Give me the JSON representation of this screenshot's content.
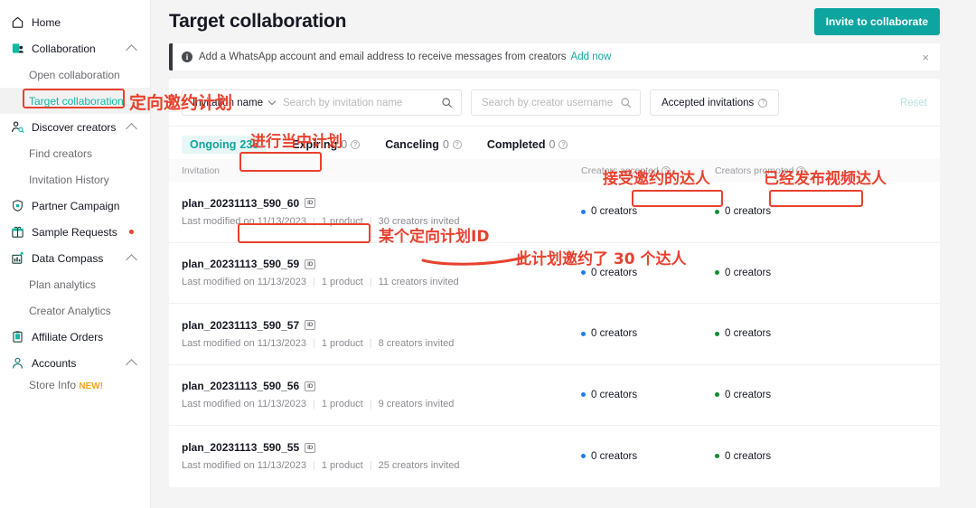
{
  "sidebar": {
    "items": [
      {
        "label": "Home",
        "icon": "home-icon",
        "type": "top",
        "expand": false
      },
      {
        "label": "Collaboration",
        "icon": "collaboration-icon",
        "type": "top",
        "expand": true
      },
      {
        "label": "Open collaboration",
        "type": "sub"
      },
      {
        "label": "Target collaboration",
        "type": "sub",
        "active": true
      },
      {
        "label": "Discover creators",
        "icon": "discover-creators-icon",
        "type": "top",
        "expand": true
      },
      {
        "label": "Find creators",
        "type": "sub"
      },
      {
        "label": "Invitation History",
        "type": "sub"
      },
      {
        "label": "Partner Campaign",
        "icon": "shield-icon",
        "type": "top",
        "expand": false
      },
      {
        "label": "Sample Requests",
        "icon": "gift-icon",
        "type": "top",
        "expand": false,
        "dot": true
      },
      {
        "label": "Data Compass",
        "icon": "data-compass-icon",
        "type": "top",
        "expand": true
      },
      {
        "label": "Plan analytics",
        "type": "sub"
      },
      {
        "label": "Creator Analytics",
        "type": "sub"
      },
      {
        "label": "Affiliate Orders",
        "icon": "clipboard-icon",
        "type": "top",
        "expand": false
      },
      {
        "label": "Accounts",
        "icon": "account-icon",
        "type": "top",
        "expand": true
      },
      {
        "label": "Store Info",
        "type": "sub",
        "badge": "NEW!"
      }
    ]
  },
  "header": {
    "title": "Target collaboration",
    "invite_button": "Invite to collaborate"
  },
  "banner": {
    "text": "Add a WhatsApp account and email address to receive messages from creators",
    "link": "Add now",
    "close": "×"
  },
  "filters": {
    "name_select": "Invitation name",
    "name_placeholder": "Search by invitation name",
    "username_placeholder": "Search by creator username",
    "accepted_button": "Accepted invitations",
    "reset": "Reset"
  },
  "tabs": [
    {
      "label": "Ongoing",
      "count": "235",
      "active": true,
      "help": false
    },
    {
      "label": "Expiring",
      "count": "0",
      "active": false,
      "help": true
    },
    {
      "label": "Canceling",
      "count": "0",
      "active": false,
      "help": true
    },
    {
      "label": "Completed",
      "count": "0",
      "active": false,
      "help": true
    }
  ],
  "table": {
    "columns": {
      "invitation": "Invitation",
      "creators_accepted": "Creators accepted",
      "creators_promoted": "Creators promoted"
    },
    "rows": [
      {
        "plan": "plan_20231113_590_60",
        "modified": "Last modified on 11/13/2023",
        "products": "1 product",
        "invited": "30 creators invited",
        "accepted": "0 creators",
        "promoted": "0 creators"
      },
      {
        "plan": "plan_20231113_590_59",
        "modified": "Last modified on 11/13/2023",
        "products": "1 product",
        "invited": "11 creators invited",
        "accepted": "0 creators",
        "promoted": "0 creators"
      },
      {
        "plan": "plan_20231113_590_57",
        "modified": "Last modified on 11/13/2023",
        "products": "1 product",
        "invited": "8 creators invited",
        "accepted": "0 creators",
        "promoted": "0 creators"
      },
      {
        "plan": "plan_20231113_590_56",
        "modified": "Last modified on 11/13/2023",
        "products": "1 product",
        "invited": "9 creators invited",
        "accepted": "0 creators",
        "promoted": "0 creators"
      },
      {
        "plan": "plan_20231113_590_55",
        "modified": "Last modified on 11/13/2023",
        "products": "1 product",
        "invited": "25 creators invited",
        "accepted": "0 creators",
        "promoted": "0 creators"
      }
    ]
  },
  "annotations": {
    "target_collaboration": "定向邀约计划",
    "ongoing": "进行当中计划",
    "creators_accepted": "接受邀约的达人",
    "creators_promoted": "已经发布视频达人",
    "plan_id": "某个定向计划ID",
    "invited_count": "此计划邀约了 30 个达人"
  },
  "colors": {
    "accent": "#0ea5a0",
    "annotation": "#e8412e",
    "accepted_dot": "#1b7ef0",
    "promoted_dot": "#0a8f2e",
    "new_badge": "#f5a623"
  }
}
